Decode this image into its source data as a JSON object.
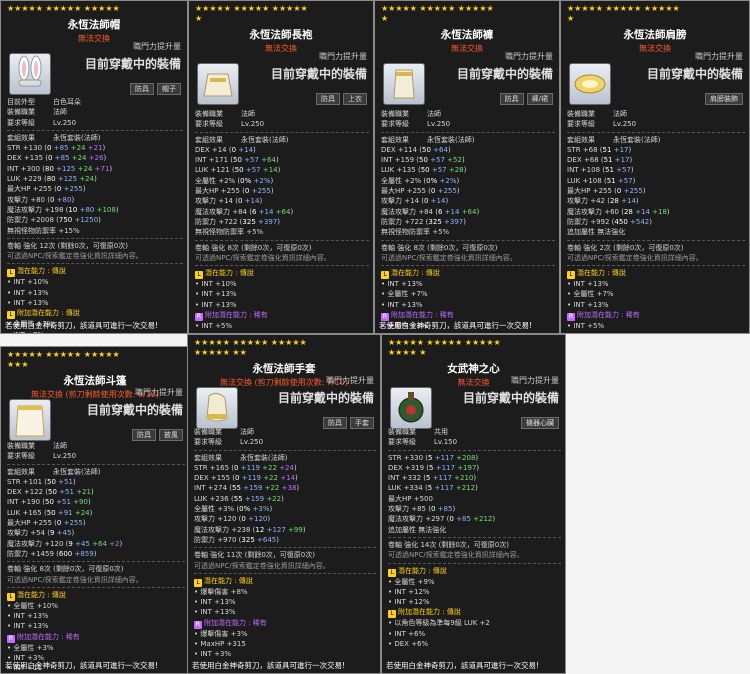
{
  "common": {
    "growth": "職門力提升量",
    "wearing": "目前穿戴中的裝備",
    "job_label": "裝備職業",
    "req_label": "要求等級",
    "set_label": "套組效果",
    "untradeable": "無法交換",
    "trade_note": "若使用白金神奇剪刀，該道具可進行一次交易!",
    "hint": "可透過NPC/探索鑑定卷強化資訊詳細內容。",
    "potential": "潛在能力 : 傳說",
    "add_potential": "附加潛在能力 : 稀有",
    "add_potential_legend": "附加潛在能力 : 傳說"
  },
  "cards": [
    {
      "stars_line1": "★★★★★ ★★★★★ ★★★★★",
      "stars_line2": "",
      "title": "永恆法師帽",
      "subtitle": "無法交換",
      "tags": [
        "防具",
        "帽子"
      ],
      "icon": "bunny-ears-hat-icon",
      "meta": [
        [
          "目前外型",
          "白色耳朵"
        ],
        [
          "裝備職業",
          "法師"
        ],
        [
          "要求等級",
          "Lv.250"
        ]
      ],
      "set": "永恆套裝(法師)",
      "stats": [
        "STR +130 (0 +85 +24 +21)",
        "DEX +135 (0 +85 +24 +26)",
        "INT +300 (80 +125 +24 +71)",
        "LUK +229 (80 +125 +24)",
        "最大HP +255 (0 +255)",
        "攻擊力 +80 (0 +80)",
        "魔法攻擊力 +198 (10 +80 +108)",
        "防禦力 +2008 (750 +1250)",
        "無視怪物防禦率 +15%"
      ],
      "enhance": "卷軸 強化 12次 (剩餘0次，可復原0次)",
      "pot": [
        "INT +10%",
        "INT +13%",
        "INT +13%"
      ],
      "apot_title": "附加潛在能力 : 傳說",
      "apot": [
        "全屬性 +7%",
        "INT +7%",
        "INT +7%"
      ],
      "footer": "若使用白金神奇剪刀，該道具可進行一次交易!"
    },
    {
      "stars_line1": "★★★★★ ★★★★★ ★★★★★",
      "stars_line2": "★",
      "title": "永恆法師長袍",
      "subtitle": "無法交換",
      "tags": [
        "防具",
        "上衣"
      ],
      "icon": "robe-top-icon",
      "meta": [
        [
          "裝備職業",
          "法師"
        ],
        [
          "要求等級",
          "Lv.250"
        ]
      ],
      "set": "永恆套裝(法師)",
      "stats": [
        "DEX +14 (0 +14)",
        "INT +171 (50 +57 +64)",
        "LUK +121 (50 +57 +14)",
        "全屬性 +2% (0% +2%)",
        "最大HP +255 (0 +255)",
        "攻擊力 +14 (0 +14)",
        "魔法攻擊力 +84 (6 +14 +64)",
        "防禦力 +722 (325 +397)",
        "無視怪物防禦率 +5%"
      ],
      "enhance": "卷軸 強化 8次 (剩餘0次，可復原0次)",
      "pot": [
        "INT +10%",
        "INT +13%",
        "INT +13%"
      ],
      "apot_title": "附加潛在能力 : 稀有",
      "apot": [
        "INT +5%",
        "MaxMP +125",
        "全屬性 +4"
      ],
      "footer": ""
    },
    {
      "stars_line1": "★★★★★ ★★★★★ ★★★★★",
      "stars_line2": "★",
      "title": "永恆法師褲",
      "subtitle": "無法交換",
      "tags": [
        "防具",
        "褲/裙"
      ],
      "icon": "robe-pants-icon",
      "meta": [
        [
          "裝備職業",
          "法師"
        ],
        [
          "要求等級",
          "Lv.250"
        ]
      ],
      "set": "永恆套裝(法師)",
      "stats": [
        "DEX +114 (50 +64)",
        "INT +159 (50 +57 +52)",
        "LUK +135 (50 +57 +28)",
        "全屬性 +2% (0% +2%)",
        "最大HP +255 (0 +255)",
        "攻擊力 +14 (0 +14)",
        "魔法攻擊力 +84 (6 +14 +64)",
        "防禦力 +722 (325 +397)",
        "無視怪物防禦率 +5%"
      ],
      "enhance": "卷軸 強化 8次 (剩餘0次，可復原0次)",
      "pot": [
        "INT +13%",
        "全屬性 +7%",
        "INT +13%"
      ],
      "apot_title": "附加潛在能力 : 稀有",
      "apot": [
        "全屬性 +3%",
        "INT +3%",
        "移動速度 +6"
      ],
      "footer": "若使用白金神奇剪刀，該道具可進行一次交易!"
    },
    {
      "stars_line1": "★★★★★ ★★★★★ ★★★★★",
      "stars_line2": "★",
      "title": "永恆法師肩膀",
      "subtitle": "無法交換",
      "tags": [
        "肩膀裝飾"
      ],
      "icon": "shoulder-pad-icon",
      "meta": [
        [
          "裝備職業",
          "法師"
        ],
        [
          "要求等級",
          "Lv.250"
        ]
      ],
      "set": "永恆套裝(法師)",
      "stats": [
        "STR +68 (51 +17)",
        "DEX +68 (51 +17)",
        "INT +108 (51 +57)",
        "LUK +108 (51 +57)",
        "最大HP +255 (0 +255)",
        "攻擊力 +42 (28 +14)",
        "魔法攻擊力 +60 (28 +14 +18)",
        "防禦力 +992 (450 +542)"
      ],
      "extra": "追加屬性 無法強化",
      "enhance": "卷軸 強化 2次 (剩餘0次，可復原0次)",
      "pot": [
        "INT +13%",
        "全屬性 +7%",
        "INT +13%"
      ],
      "apot_title": "附加潛在能力 : 稀有",
      "apot": [
        "INT +5%",
        "MaxMP +125",
        "魔法攻擊力 +11"
      ],
      "footer": ""
    },
    {
      "stars_line1": "★★★★★ ★★★★★ ★★★★★",
      "stars_line2": "★★★",
      "title": "永恆法師斗篷",
      "subtitle": "無法交換 (剪刀剩餘使用次數: 9/10)",
      "tags": [
        "防具",
        "披風"
      ],
      "icon": "cape-icon",
      "meta": [
        [
          "裝備職業",
          "法師"
        ],
        [
          "要求等級",
          "Lv.250"
        ]
      ],
      "set": "永恆套裝(法師)",
      "stats": [
        "STR +101 (50 +51)",
        "DEX +122 (50 +51 +21)",
        "INT +190 (50 +51 +90)",
        "LUK +165 (50 +91 +24)",
        "最大HP +255 (0 +255)",
        "攻擊力 +54 (9 +45)",
        "魔法攻擊力 +120 (9 +45 +64 +2)",
        "防禦力 +1459 (600 +859)"
      ],
      "enhance": "卷軸 強化 8次 (剩餘0次，可復原0次)",
      "pot": [
        "全屬性 +10%",
        "INT +13%",
        "INT +13%"
      ],
      "apot_title": "附加潛在能力 : 稀有",
      "apot": [
        "全屬性 +3%",
        "INT +3%",
        "INT +11"
      ],
      "footer": "若使用白金神奇剪刀，該道具可進行一次交易!"
    },
    {
      "stars_line1": "★★★★★ ★★★★★ ★★★★★",
      "stars_line2": "★★★★★ ★★",
      "title": "永恆法師手套",
      "subtitle": "無法交換 (剪刀剩餘使用次數: 7/10)",
      "tags": [
        "防具",
        "手套"
      ],
      "icon": "glove-icon",
      "meta": [
        [
          "裝備職業",
          "法師"
        ],
        [
          "要求等級",
          "Lv.250"
        ]
      ],
      "set": "永恆套裝(法師)",
      "stats": [
        "STR +165 (0 +119 +22 +24)",
        "DEX +155 (0 +119 +22 +14)",
        "INT +274 (55 +159 +22 +38)",
        "LUK +236 (55 +159 +22)",
        "全屬性 +3% (0% +3%)",
        "攻擊力 +120 (0 +120)",
        "魔法攻擊力 +238 (12 +127 +99)",
        "防禦力 +970 (325 +645)"
      ],
      "enhance": "卷軸 強化 11次 (剩餘0次，可復原0次)",
      "pot": [
        "爆擊傷害 +8%",
        "INT +13%",
        "INT +13%"
      ],
      "apot_title": "附加潛在能力 : 稀有",
      "apot": [
        "爆擊傷害 +3%",
        "MaxHP +315",
        "INT +3%"
      ],
      "footer": "若使用白金神奇剪刀，該道具可進行一次交易!"
    },
    {
      "stars_line1": "★★★★★ ★★★★★ ★★★★★",
      "stars_line2": "★★★★ ★",
      "title": "女武神之心",
      "subtitle": "無法交換",
      "tags": [
        "機器心臟"
      ],
      "icon": "heart-device-icon",
      "meta": [
        [
          "裝備職業",
          "共用"
        ],
        [
          "要求等級",
          "Lv.150"
        ]
      ],
      "set": "",
      "stats": [
        "STR +330 (5 +117 +208)",
        "DEX +319 (5 +117 +197)",
        "INT +332 (5 +117 +210)",
        "LUK +334 (5 +117 +212)",
        "最大HP +500",
        "攻擊力 +85 (0 +85)",
        "魔法攻擊力 +297 (0 +85 +212)"
      ],
      "extra": "追加屬性 無法強化",
      "enhance": "卷軸 強化 14次 (剩餘0次，可復原0次)",
      "pot": [
        "全屬性 +9%",
        "INT +12%",
        "INT +12%"
      ],
      "apot_title": "附加潛在能力 : 傳說",
      "apot": [
        "以角色等級為準每9級 LUK +2",
        "INT +6%",
        "DEX +6%"
      ],
      "footer": "若使用白金神奇剪刀，該道具可進行一次交易!"
    }
  ]
}
